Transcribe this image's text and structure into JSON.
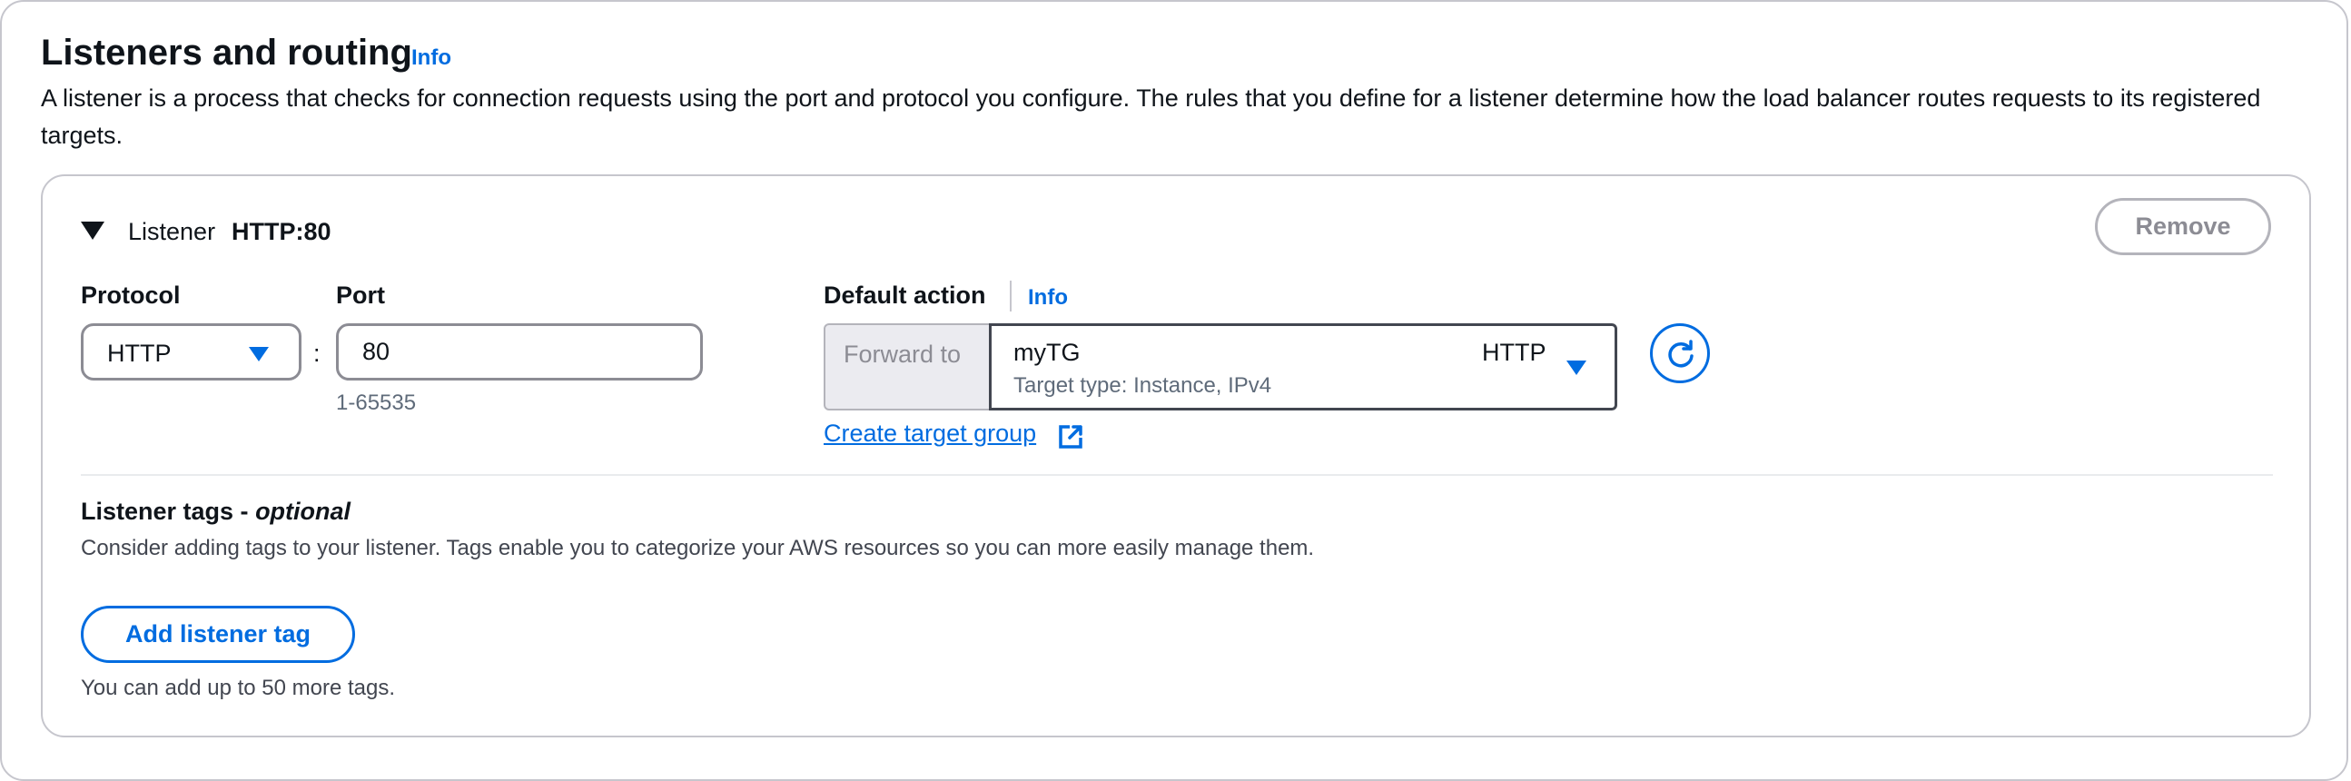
{
  "section": {
    "title": "Listeners and routing",
    "info_label": "Info",
    "description": "A listener is a process that checks for connection requests using the port and protocol you configure. The rules that you define for a listener determine how the load balancer routes requests to its registered targets."
  },
  "listener": {
    "label": "Listener",
    "value": "HTTP:80",
    "remove_label": "Remove",
    "protocol": {
      "label": "Protocol",
      "value": "HTTP"
    },
    "separator": ":",
    "port": {
      "label": "Port",
      "value": "80",
      "hint": "1-65535"
    },
    "default_action": {
      "label": "Default action",
      "info_label": "Info",
      "forward_label": "Forward to",
      "target_group": {
        "name": "myTG",
        "protocol": "HTTP",
        "description": "Target type: Instance, IPv4"
      },
      "create_link": "Create target group"
    },
    "tags": {
      "title": "Listener tags -",
      "title_optional": "optional",
      "description": "Consider adding tags to your listener. Tags enable you to categorize your AWS resources so you can more easily manage them.",
      "add_label": "Add listener tag",
      "limit_text": "You can add up to 50 more tags."
    }
  },
  "icons": {
    "expand": "caret-down-icon",
    "protocol_dropdown": "caret-down-icon",
    "target_group_dropdown": "caret-down-icon",
    "refresh": "refresh-icon",
    "external_link": "external-link-icon"
  },
  "colors": {
    "accent": "#006ce0",
    "text": "#0f141a",
    "muted": "#5f6b7a",
    "border": "#c6c6cd",
    "disabled": "#8c8c94"
  }
}
